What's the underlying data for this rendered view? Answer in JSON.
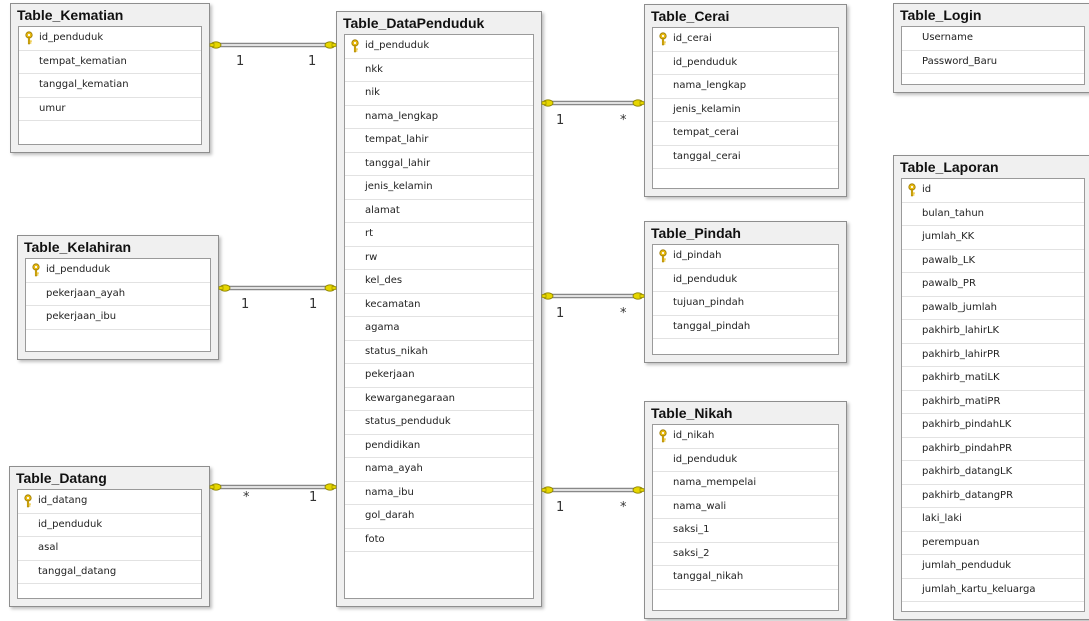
{
  "tables": [
    {
      "id": "kematian",
      "title": "Table_Kematian",
      "columns": [
        {
          "name": "id_penduduk",
          "pk": true
        },
        {
          "name": "tempat_kematian"
        },
        {
          "name": "tanggal_kematian"
        },
        {
          "name": "umur"
        }
      ]
    },
    {
      "id": "kelahiran",
      "title": "Table_Kelahiran",
      "columns": [
        {
          "name": "id_penduduk",
          "pk": true
        },
        {
          "name": "pekerjaan_ayah"
        },
        {
          "name": "pekerjaan_ibu"
        }
      ]
    },
    {
      "id": "datang",
      "title": "Table_Datang",
      "columns": [
        {
          "name": "id_datang",
          "pk": true
        },
        {
          "name": "id_penduduk"
        },
        {
          "name": "asal"
        },
        {
          "name": "tanggal_datang"
        }
      ]
    },
    {
      "id": "datapenduduk",
      "title": "Table_DataPenduduk",
      "columns": [
        {
          "name": "id_penduduk",
          "pk": true
        },
        {
          "name": "nkk"
        },
        {
          "name": "nik"
        },
        {
          "name": "nama_lengkap"
        },
        {
          "name": "tempat_lahir"
        },
        {
          "name": "tanggal_lahir"
        },
        {
          "name": "jenis_kelamin"
        },
        {
          "name": "alamat"
        },
        {
          "name": "rt"
        },
        {
          "name": "rw"
        },
        {
          "name": "kel_des"
        },
        {
          "name": "kecamatan"
        },
        {
          "name": "agama"
        },
        {
          "name": "status_nikah"
        },
        {
          "name": "pekerjaan"
        },
        {
          "name": "kewarganegaraan"
        },
        {
          "name": "status_penduduk"
        },
        {
          "name": "pendidikan"
        },
        {
          "name": "nama_ayah"
        },
        {
          "name": "nama_ibu"
        },
        {
          "name": "gol_darah"
        },
        {
          "name": "foto"
        }
      ]
    },
    {
      "id": "cerai",
      "title": "Table_Cerai",
      "columns": [
        {
          "name": "id_cerai",
          "pk": true
        },
        {
          "name": "id_penduduk"
        },
        {
          "name": "nama_lengkap"
        },
        {
          "name": "jenis_kelamin"
        },
        {
          "name": "tempat_cerai"
        },
        {
          "name": "tanggal_cerai"
        }
      ]
    },
    {
      "id": "pindah",
      "title": "Table_Pindah",
      "columns": [
        {
          "name": "id_pindah",
          "pk": true
        },
        {
          "name": "id_penduduk"
        },
        {
          "name": "tujuan_pindah"
        },
        {
          "name": "tanggal_pindah"
        }
      ]
    },
    {
      "id": "nikah",
      "title": "Table_Nikah",
      "columns": [
        {
          "name": "id_nikah",
          "pk": true
        },
        {
          "name": "id_penduduk"
        },
        {
          "name": "nama_mempelai"
        },
        {
          "name": "nama_wali"
        },
        {
          "name": "saksi_1"
        },
        {
          "name": "saksi_2"
        },
        {
          "name": "tanggal_nikah"
        }
      ]
    },
    {
      "id": "login",
      "title": "Table_Login",
      "columns": [
        {
          "name": "Username"
        },
        {
          "name": "Password_Baru"
        }
      ]
    },
    {
      "id": "laporan",
      "title": "Table_Laporan",
      "columns": [
        {
          "name": "id",
          "pk": true
        },
        {
          "name": "bulan_tahun"
        },
        {
          "name": "jumlah_KK"
        },
        {
          "name": "pawalb_LK"
        },
        {
          "name": "pawalb_PR"
        },
        {
          "name": "pawalb_jumlah"
        },
        {
          "name": "pakhirb_lahirLK"
        },
        {
          "name": "pakhirb_lahirPR"
        },
        {
          "name": "pakhirb_matiLK"
        },
        {
          "name": "pakhirb_matiPR"
        },
        {
          "name": "pakhirb_pindahLK"
        },
        {
          "name": "pakhirb_pindahPR"
        },
        {
          "name": "pakhirb_datangLK"
        },
        {
          "name": "pakhirb_datangPR"
        },
        {
          "name": "laki_laki"
        },
        {
          "name": "perempuan"
        },
        {
          "name": "jumlah_penduduk"
        },
        {
          "name": "jumlah_kartu_keluarga"
        }
      ]
    }
  ],
  "relationships": [
    {
      "id": "kematian-datapenduduk",
      "from_label": "1",
      "to_label": "1"
    },
    {
      "id": "kelahiran-datapenduduk",
      "from_label": "1",
      "to_label": "1"
    },
    {
      "id": "datang-datapenduduk",
      "from_label": "*",
      "to_label": "1"
    },
    {
      "id": "datapenduduk-cerai",
      "from_label": "1",
      "to_label": "*"
    },
    {
      "id": "datapenduduk-pindah",
      "from_label": "1",
      "to_label": "*"
    },
    {
      "id": "datapenduduk-nikah",
      "from_label": "1",
      "to_label": "*"
    }
  ],
  "colors": {
    "key_icon": "#e8b90f",
    "connector": "#888888",
    "end_cap": "#e6d600"
  }
}
